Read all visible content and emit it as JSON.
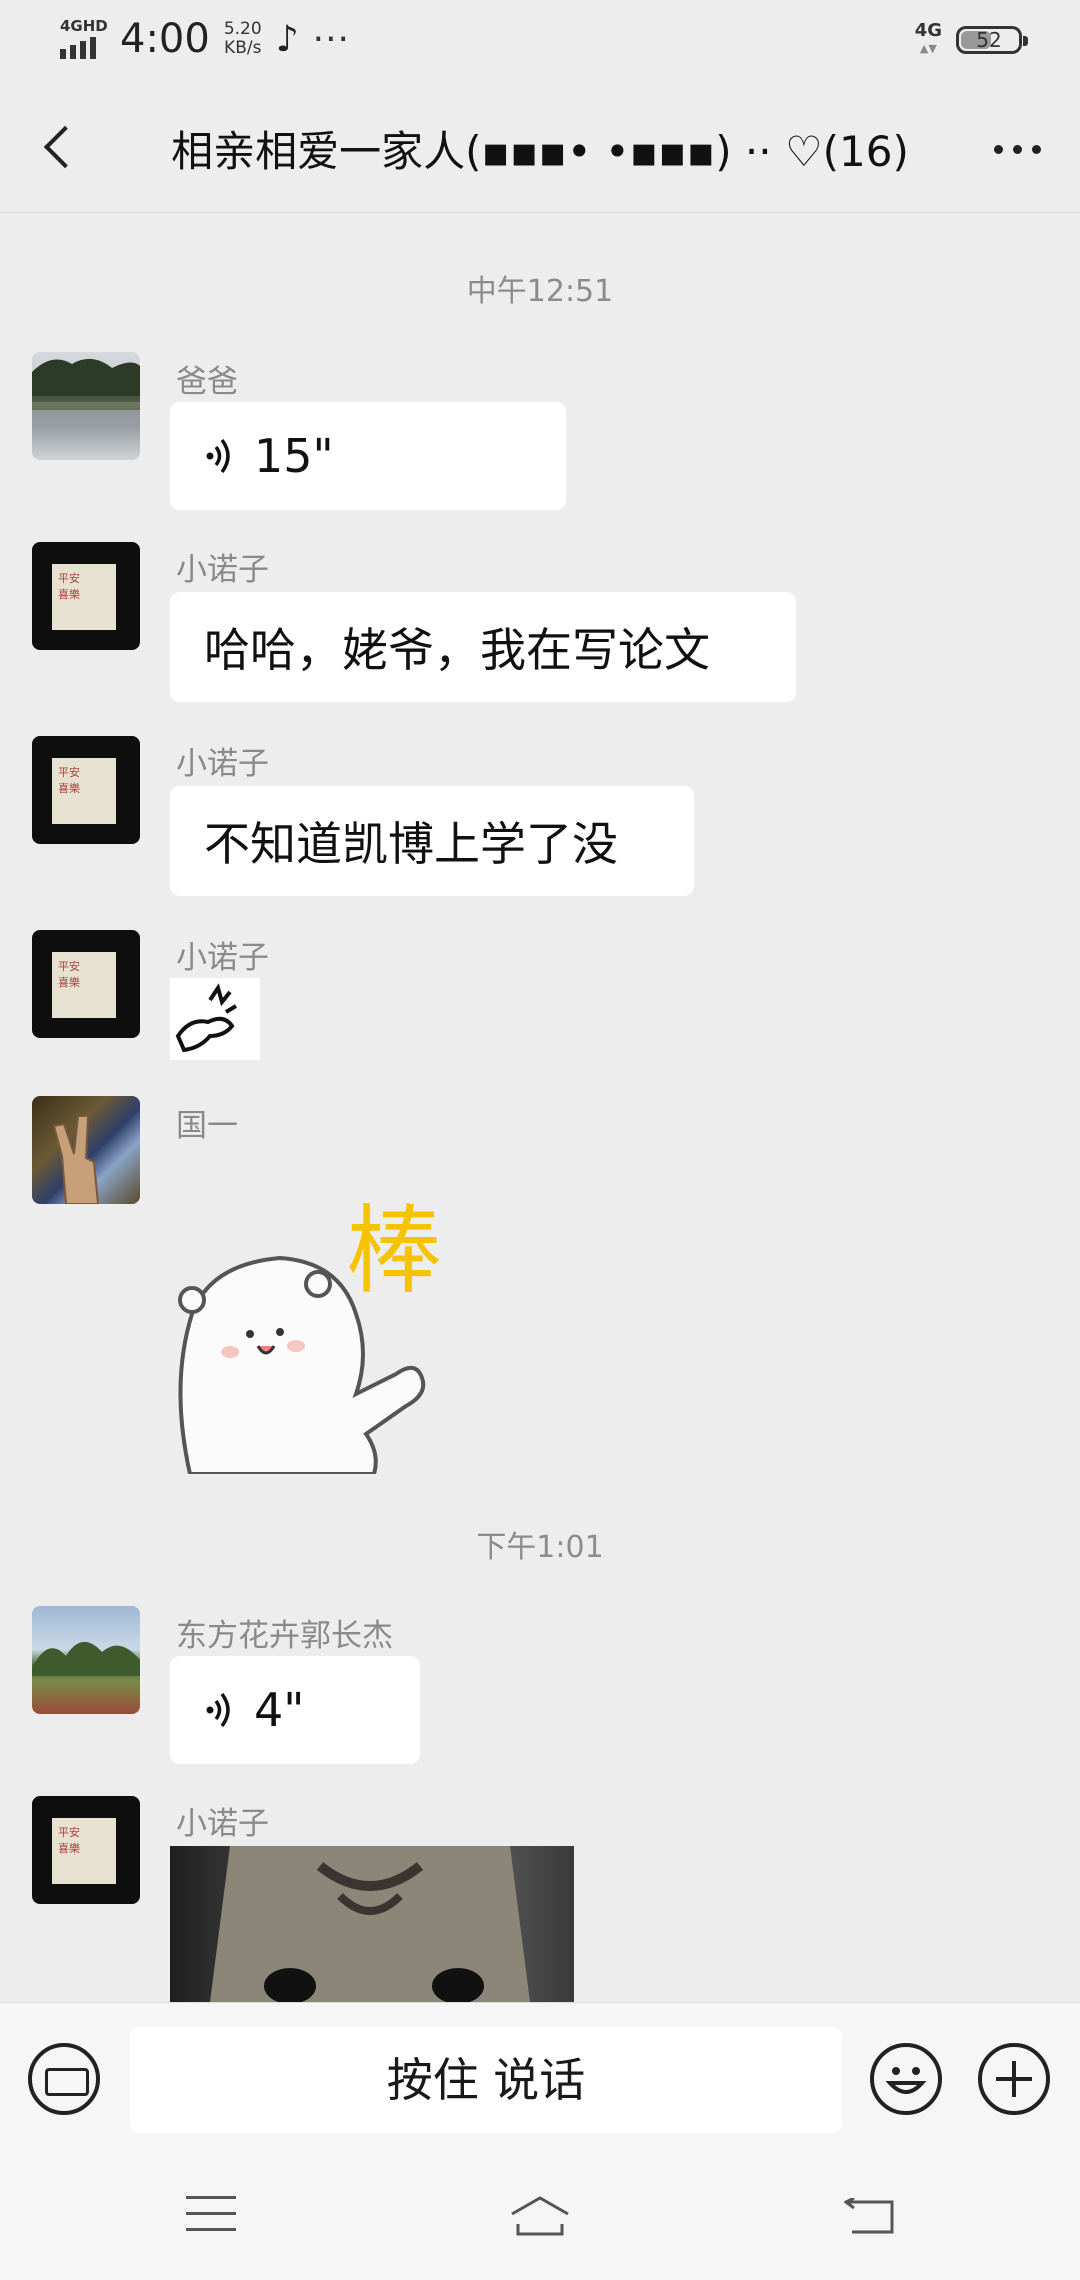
{
  "status_bar": {
    "network": "4GHD",
    "time": "4:00",
    "speed_value": "5.20",
    "speed_unit": "KB/s",
    "more": "···",
    "net_type": "4G",
    "battery": "52"
  },
  "header": {
    "back_icon": "chevron-left",
    "title": "相亲相爱一家人(▪▪▪• •▪▪▪) ·· ♡(16)",
    "more_icon": "more-dots"
  },
  "messages": [
    {
      "type": "timestamp",
      "text": "中午12:51"
    },
    {
      "type": "voice",
      "sender": "爸爸",
      "duration": "15\""
    },
    {
      "type": "text",
      "sender": "小诺子",
      "text": "哈哈，姥爷，我在写论文"
    },
    {
      "type": "text",
      "sender": "小诺子",
      "text": "不知道凯博上学了没"
    },
    {
      "type": "sticker",
      "sender": "小诺子"
    },
    {
      "type": "sticker",
      "sender": "国一",
      "sticker_text": "棒"
    },
    {
      "type": "timestamp",
      "text": "下午1:01"
    },
    {
      "type": "voice",
      "sender": "东方花卉郭长杰",
      "duration": "4\""
    },
    {
      "type": "image",
      "sender": "小诺子"
    }
  ],
  "input_bar": {
    "keyboard_icon": "keyboard",
    "hold_to_talk": "按住 说话",
    "emoji_icon": "smiley",
    "plus_icon": "plus"
  },
  "system_nav": {
    "menu_icon": "menu-lines",
    "home_icon": "home-house",
    "back_icon": "back-arrow"
  }
}
